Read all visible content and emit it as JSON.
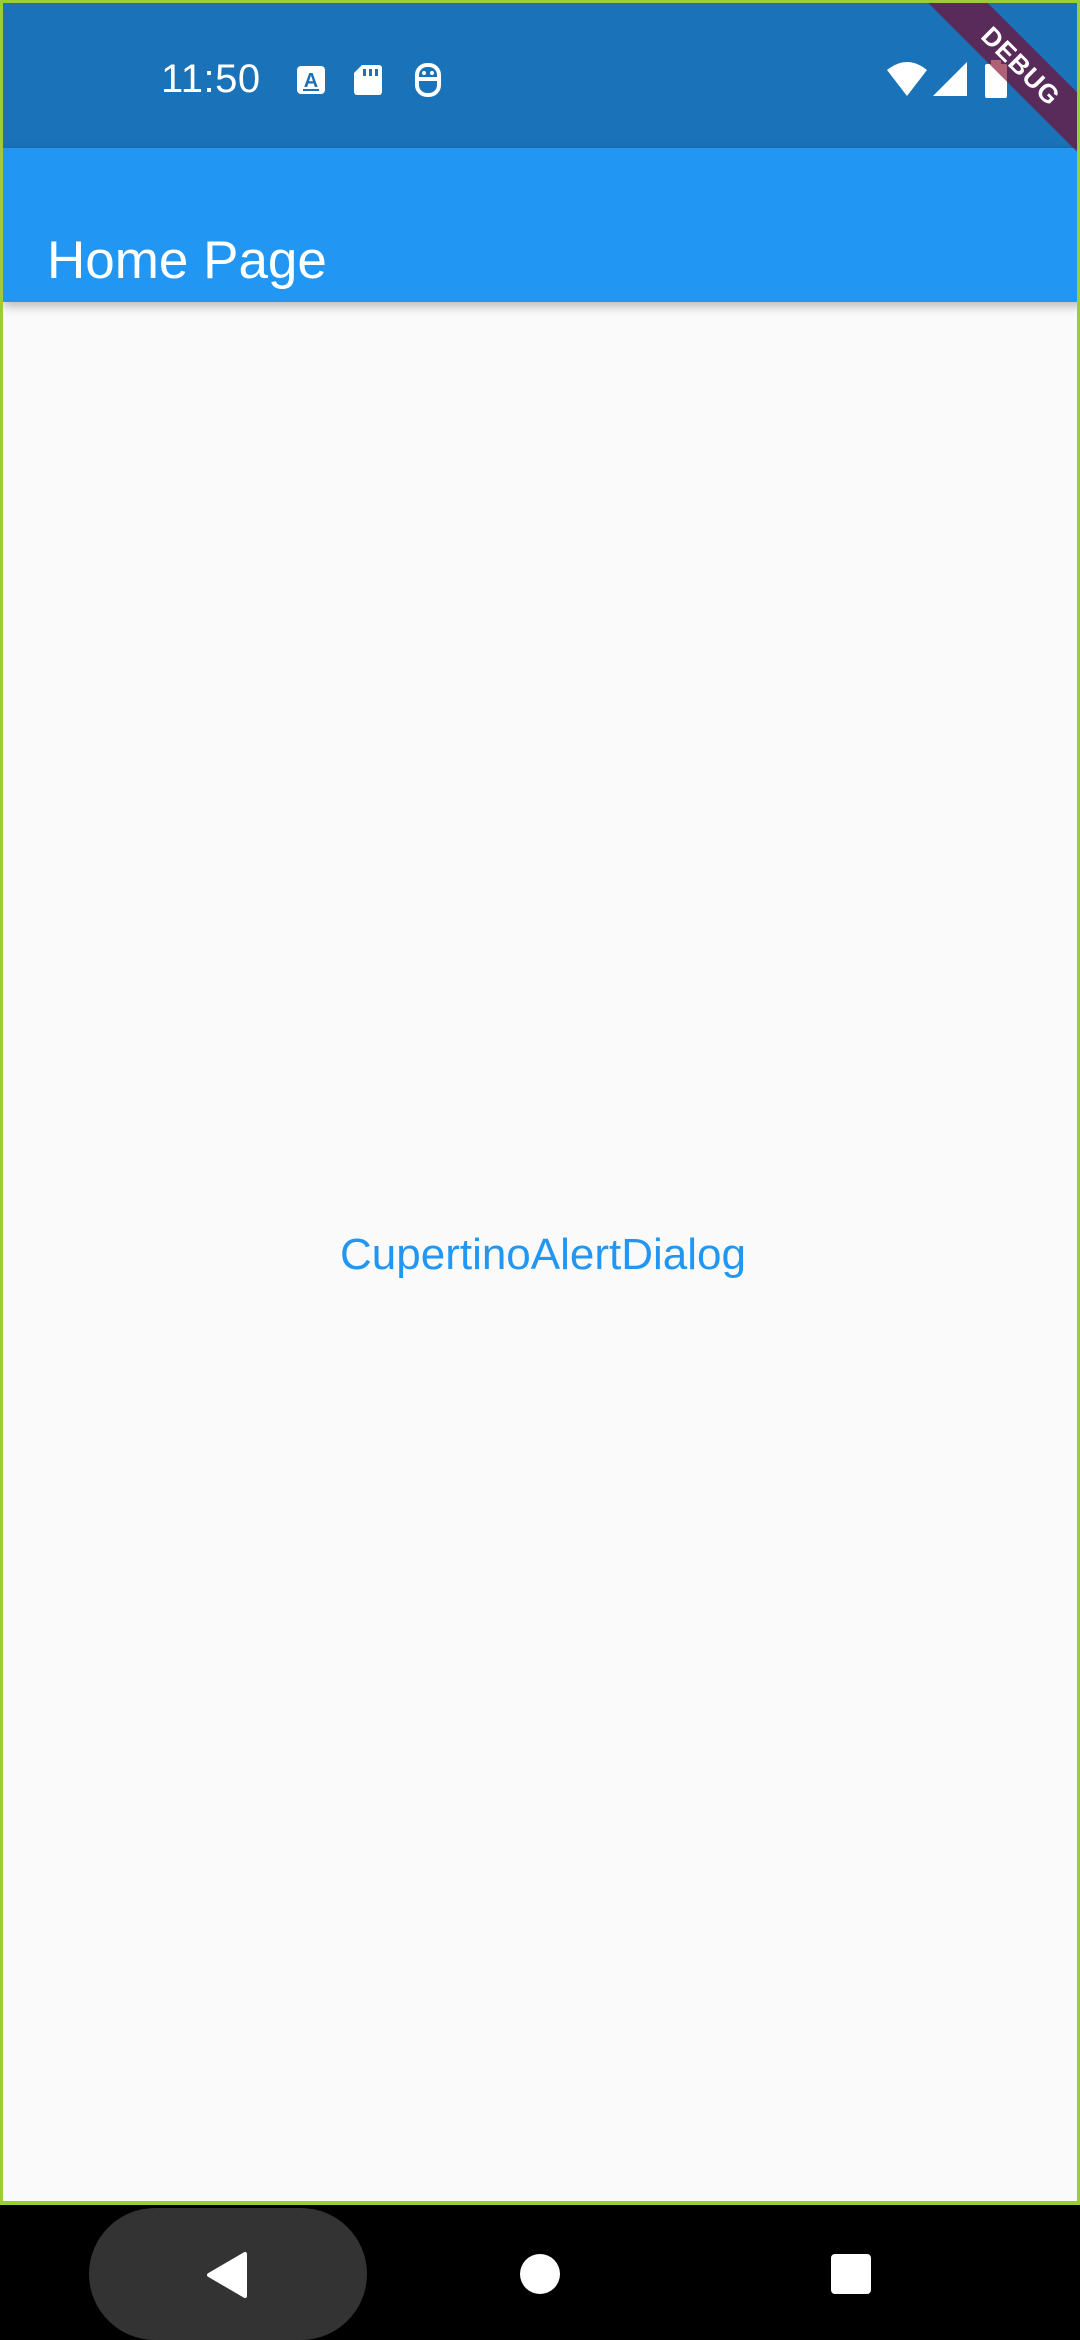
{
  "status_bar": {
    "time": "11:50",
    "left_icons": [
      "text-a-icon",
      "sd-card-icon",
      "privacy-icon"
    ],
    "right_icons": [
      "wifi-icon",
      "cellular-signal-icon",
      "battery-icon"
    ],
    "color": "#1a72b9"
  },
  "debug_banner": {
    "label": "DEBUG"
  },
  "app_bar": {
    "title": "Home Page",
    "color": "#2196f3"
  },
  "main": {
    "button_label": "CupertinoAlertDialog",
    "button_color": "#2196f3",
    "background": "#fafafa"
  },
  "nav_bar": {
    "buttons": [
      "back-icon",
      "home-icon",
      "recents-icon"
    ]
  }
}
